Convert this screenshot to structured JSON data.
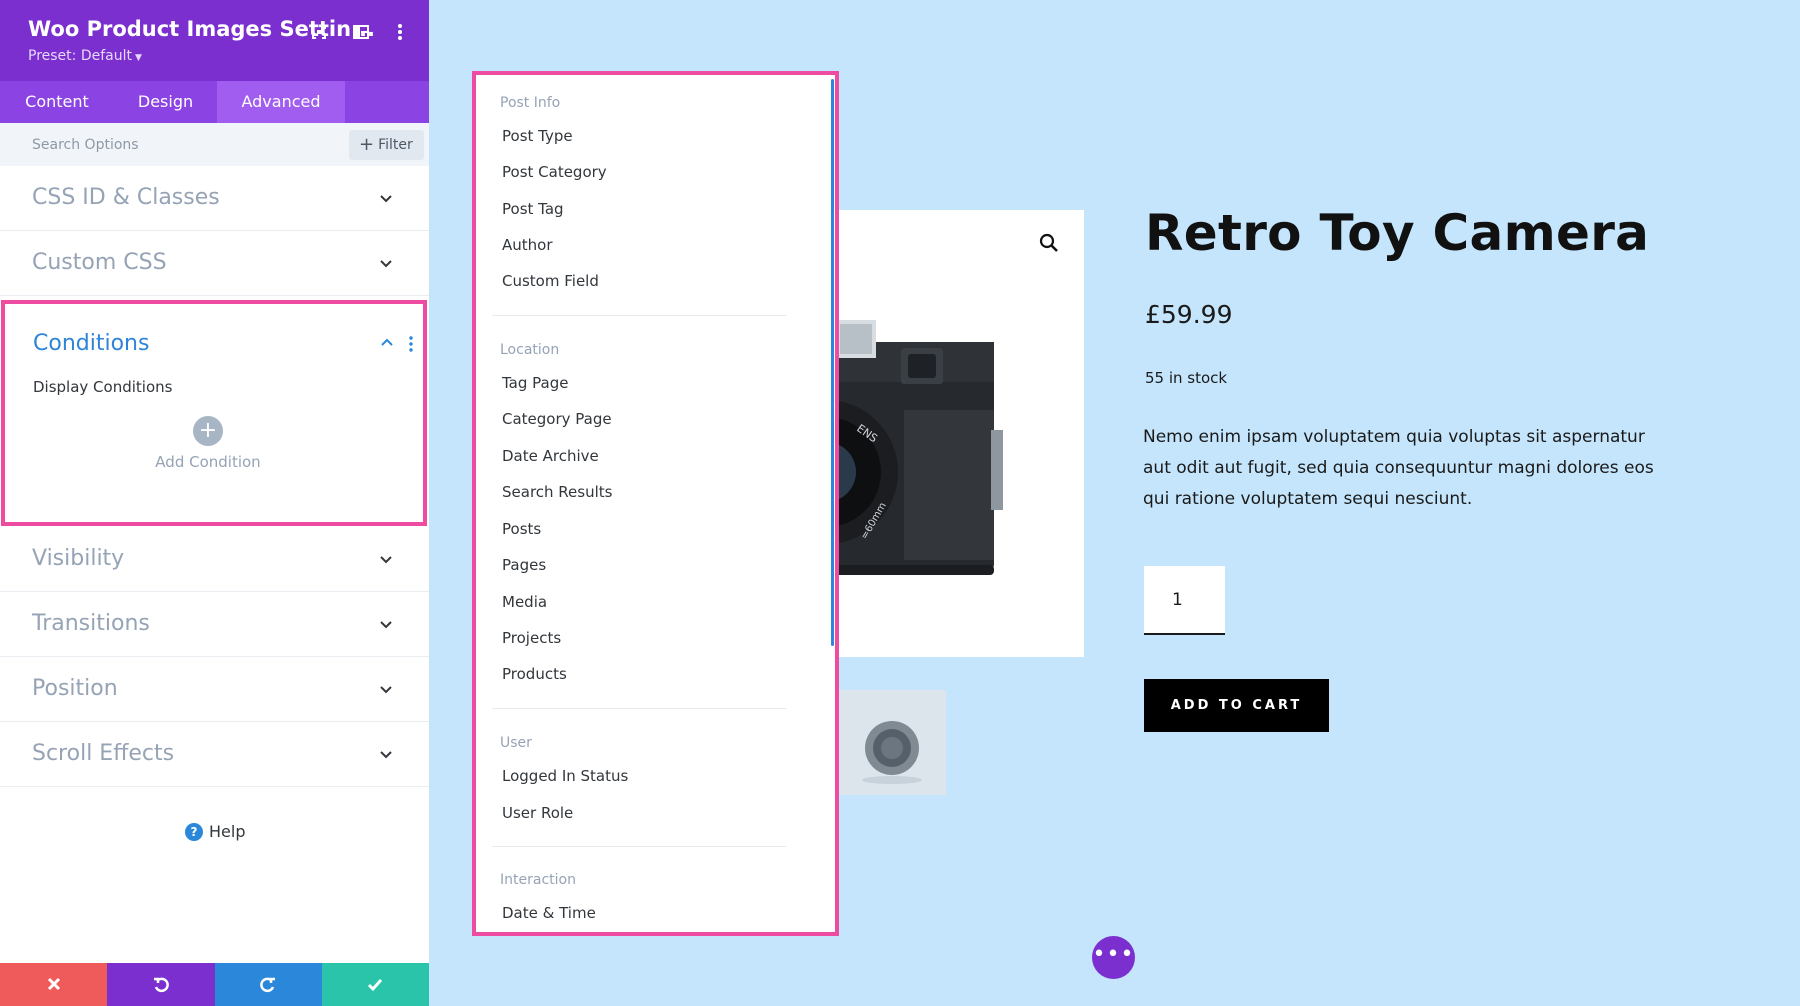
{
  "panel": {
    "title": "Woo Product Images Settin...",
    "preset": "Preset: Default",
    "tabs": [
      "Content",
      "Design",
      "Advanced"
    ],
    "active_tab": "Advanced",
    "search_placeholder": "Search Options",
    "filter_label": "Filter",
    "toggles": [
      "CSS ID & Classes",
      "Custom CSS",
      "Conditions",
      "Visibility",
      "Transitions",
      "Position",
      "Scroll Effects"
    ],
    "conditions": {
      "title": "Conditions",
      "display_conditions": "Display Conditions",
      "add_condition": "Add Condition"
    },
    "help": "Help"
  },
  "dropdown": {
    "groups": [
      {
        "label": "Post Info",
        "items": [
          "Post Type",
          "Post Category",
          "Post Tag",
          "Author",
          "Custom Field"
        ]
      },
      {
        "label": "Location",
        "items": [
          "Tag Page",
          "Category Page",
          "Date Archive",
          "Search Results",
          "Posts",
          "Pages",
          "Media",
          "Projects",
          "Products"
        ]
      },
      {
        "label": "User",
        "items": [
          "Logged In Status",
          "User Role"
        ]
      },
      {
        "label": "Interaction",
        "items": [
          "Date & Time"
        ]
      }
    ]
  },
  "product": {
    "title": "Retro Toy Camera",
    "price": "£59.99",
    "stock": "55 in stock",
    "description": "Nemo enim ipsam voluptatem quia voluptas sit aspernatur aut odit aut fugit, sed quia consequuntur magni dolores eos qui ratione voluptatem sequi nesciunt.",
    "quantity": "1",
    "add_to_cart": "ADD TO CART",
    "camera_lens_text": "ENS",
    "camera_focal_text": "=60mm"
  },
  "colors": {
    "panel_header": "#7b2fcf",
    "tabs_bar": "#8c43e4",
    "active_tab": "#a15cf0",
    "highlight_border": "#ee4ca0",
    "accent_blue": "#2b87da",
    "page_background": "#c4e5fc",
    "cancel": "#ef5a5a",
    "undo": "#7b2fcf",
    "redo": "#2b87da",
    "save": "#29c4a9"
  },
  "icons": {
    "header": [
      "fullscreen-icon",
      "layout-icon",
      "more-vertical-icon"
    ],
    "footer": [
      "close-icon",
      "undo-icon",
      "redo-icon",
      "check-icon"
    ]
  }
}
